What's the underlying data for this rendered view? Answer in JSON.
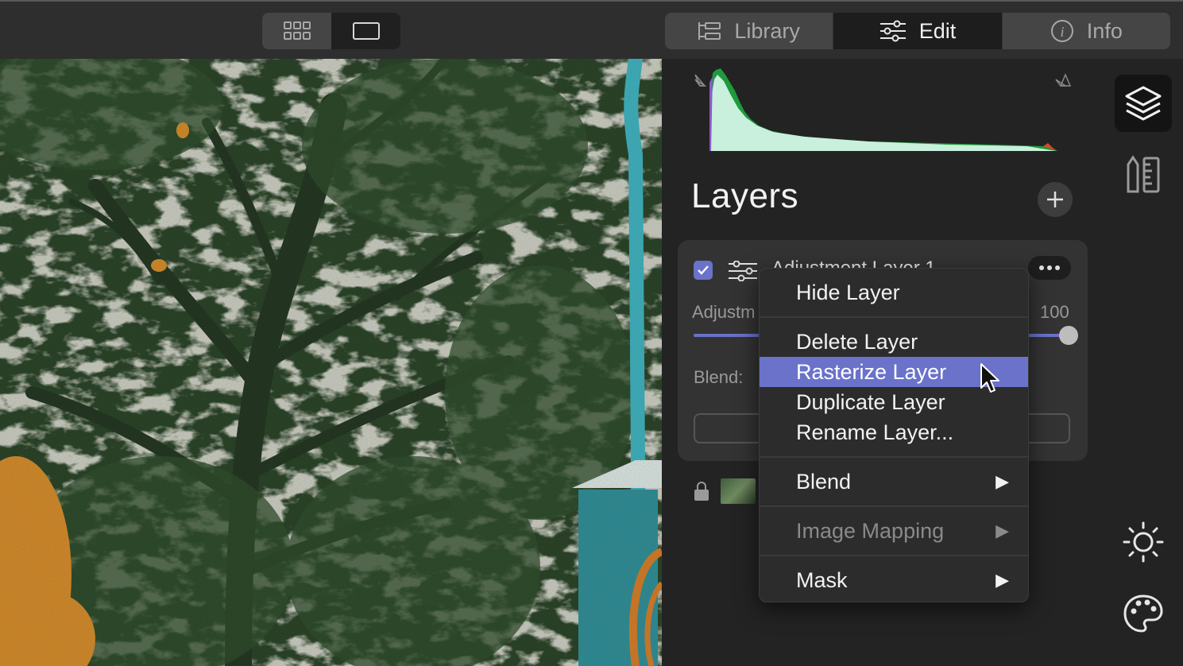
{
  "topbar": {
    "view_modes": [
      "grid-view",
      "single-view"
    ],
    "active_view": "single-view",
    "tabs": [
      {
        "label": "Library",
        "icon": "library-icon",
        "active": false
      },
      {
        "label": "Edit",
        "icon": "sliders-icon",
        "active": true
      },
      {
        "label": "Info",
        "icon": "info-icon",
        "active": false
      }
    ]
  },
  "layers": {
    "title": "Layers",
    "layer": {
      "name": "Adjustment Layer 1",
      "checked": true,
      "adjust_label": "Adjustm",
      "opacity": "100",
      "blend_label": "Blend:"
    }
  },
  "context_menu": {
    "items": {
      "hide": "Hide Layer",
      "delete": "Delete Layer",
      "rasterize": "Rasterize Layer",
      "duplicate": "Duplicate Layer",
      "rename": "Rename Layer...",
      "blend": "Blend",
      "mapping": "Image Mapping",
      "mask": "Mask"
    },
    "highlighted": "Rasterize Layer",
    "disabled": [
      "Image Mapping"
    ]
  },
  "colors": {
    "accent": "#6a72c9",
    "panel_bg": "#232323",
    "card_bg": "#333333"
  }
}
